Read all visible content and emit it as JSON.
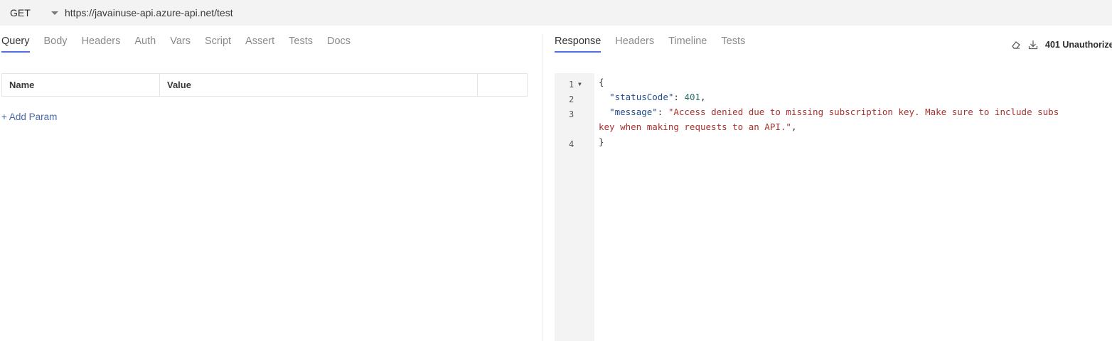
{
  "request": {
    "method": "GET",
    "url": "https://javainuse-api.azure-api.net/test",
    "tabs": [
      "Query",
      "Body",
      "Headers",
      "Auth",
      "Vars",
      "Script",
      "Assert",
      "Tests",
      "Docs"
    ],
    "active_tab": "Query",
    "params_table": {
      "headers": [
        "Name",
        "Value",
        ""
      ]
    },
    "add_param_label": "+ Add Param"
  },
  "response": {
    "tabs": [
      "Response",
      "Headers",
      "Timeline",
      "Tests"
    ],
    "active_tab": "Response",
    "status": "401 Unauthorize",
    "line_numbers": [
      "1",
      "2",
      "3",
      "4"
    ],
    "code": {
      "open": "{",
      "key1": "\"statusCode\"",
      "val1": "401",
      "key2": "\"message\"",
      "msg_line1": "\"Access denied due to missing subscription key. Make sure to include subs",
      "msg_line2": "key when making requests to an API.\"",
      "close": "}"
    }
  }
}
